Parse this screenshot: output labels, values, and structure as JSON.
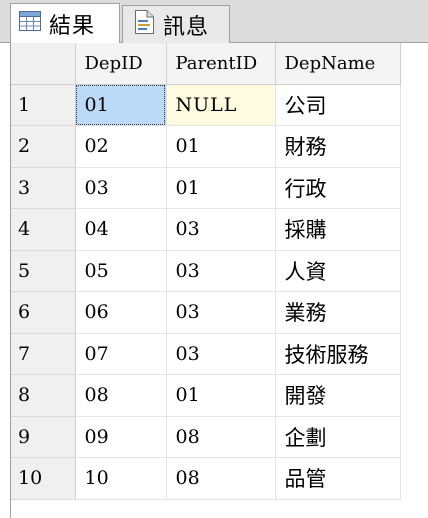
{
  "tabs": [
    {
      "label": "結果",
      "icon": "grid-results-icon",
      "active": true
    },
    {
      "label": "訊息",
      "icon": "messages-document-icon",
      "active": false
    }
  ],
  "grid": {
    "columns": [
      "DepID",
      "ParentID",
      "DepName"
    ],
    "rows": [
      {
        "num": "1",
        "DepID": "01",
        "ParentID": "NULL",
        "DepName": "公司"
      },
      {
        "num": "2",
        "DepID": "02",
        "ParentID": "01",
        "DepName": "財務"
      },
      {
        "num": "3",
        "DepID": "03",
        "ParentID": "01",
        "DepName": "行政"
      },
      {
        "num": "4",
        "DepID": "04",
        "ParentID": "03",
        "DepName": "採購"
      },
      {
        "num": "5",
        "DepID": "05",
        "ParentID": "03",
        "DepName": "人資"
      },
      {
        "num": "6",
        "DepID": "06",
        "ParentID": "03",
        "DepName": "業務"
      },
      {
        "num": "7",
        "DepID": "07",
        "ParentID": "03",
        "DepName": "技術服務"
      },
      {
        "num": "8",
        "DepID": "08",
        "ParentID": "01",
        "DepName": "開發"
      },
      {
        "num": "9",
        "DepID": "09",
        "ParentID": "08",
        "DepName": "企劃"
      },
      {
        "num": "10",
        "DepID": "10",
        "ParentID": "08",
        "DepName": "品管"
      }
    ],
    "selected_cell": "DepID of row 1",
    "colors": {
      "selected_bg": "#bcd9f7",
      "null_bg": "#fffbe0",
      "header_bg": "#f4f4f4",
      "tabstrip_bg": "#dcdcdc"
    }
  }
}
